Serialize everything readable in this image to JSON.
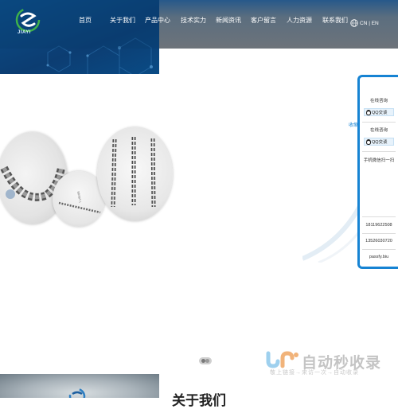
{
  "brand": {
    "logo_text": "JIAYI"
  },
  "nav": {
    "items": [
      "首页",
      "关于我们",
      "产品中心",
      "技术实力",
      "新闻资讯",
      "客户留言",
      "人力资源",
      "联系我们"
    ]
  },
  "lang": {
    "label": "CN | EN"
  },
  "side_panel": {
    "collapse_label": "收缩",
    "consult_1": "在线咨询",
    "qq_1": "QQ交谈",
    "consult_2": "在线咨询",
    "qq_2": "QQ交谈",
    "wechat_label": "手机微信扫一扫",
    "phone_1": "18119622508",
    "phone_2": "13526030720",
    "email": "passfy.biu"
  },
  "slider": {
    "active_index": 1,
    "count": 2
  },
  "watermark": {
    "title": "自动秒收录",
    "subtitle": "敬上链接→来访一次→自动收录"
  },
  "about": {
    "title": "关于我们"
  },
  "colors": {
    "accent": "#1683d3",
    "header_dark": "#0c3d72"
  }
}
